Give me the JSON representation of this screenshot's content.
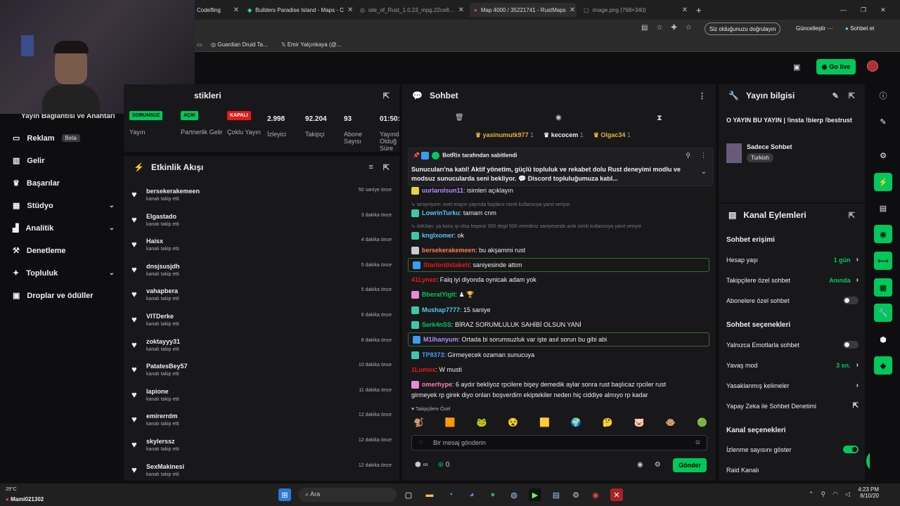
{
  "browser": {
    "tabs": [
      {
        "label": "Codefling"
      },
      {
        "label": "Builders Paradise Island - Maps - C"
      },
      {
        "label": "isle_of_Rust_1.0.23_mpg.22ce8..."
      },
      {
        "label": "Map 4000 / 35221741 - RustMaps"
      },
      {
        "label": "image.png (768×340)"
      }
    ],
    "verify_pill": "Siz olduğunuzu doğrulayın",
    "update_label": "Güncelleştir",
    "chat_label": "Sohbet et",
    "bookmarks": [
      "Guardian Druid Ta...",
      "Emir Yalçınkaya (@..."
    ]
  },
  "header": {
    "go_live": "Go live"
  },
  "sidebar": {
    "overlap_text": "Yayın Bağlantısı ve Anahtarı",
    "items": [
      {
        "label": "Reklam",
        "badge": "Beta"
      },
      {
        "label": "Gelir"
      },
      {
        "label": "Başarılar"
      },
      {
        "label": "Stüdyo"
      },
      {
        "label": "Analitik"
      },
      {
        "label": "Denetleme"
      },
      {
        "label": "Topluluk"
      },
      {
        "label": "Droplar ve ödüller"
      }
    ]
  },
  "stats": {
    "title": "stikleri",
    "cols": [
      {
        "pill": "SORUNSUZ",
        "pill_color": "#00c85a",
        "label": "Yayın"
      },
      {
        "pill": "AÇIK",
        "pill_color": "#00c85a",
        "label": "Partnerlik Gelir"
      },
      {
        "pill": "KAPALI",
        "pill_color": "#e91916",
        "label": "Çoklu Yayın"
      },
      {
        "num": "2.998",
        "label": "İzleyici"
      },
      {
        "num": "92.204",
        "label": "Takipçi"
      },
      {
        "num": "93",
        "label": "Abone Sayısı"
      },
      {
        "num": "01:50:",
        "label": "Yayında Olduğ Süre"
      }
    ]
  },
  "activity": {
    "title": "Etkinlik Akışı",
    "sub": "kanalı takip etti",
    "items": [
      {
        "name": "bersekerakemeen",
        "time": "50 saniye önce"
      },
      {
        "name": "Elgastado",
        "time": "3 dakika önce"
      },
      {
        "name": "Haisx",
        "time": "4 dakika önce"
      },
      {
        "name": "dnsjsusjdh",
        "time": "5 dakika önce"
      },
      {
        "name": "vahapbera",
        "time": "5 dakika önce"
      },
      {
        "name": "VITDerke",
        "time": "6 dakika önce"
      },
      {
        "name": "zoktayyy31",
        "time": "8 dakika önce"
      },
      {
        "name": "PatatesBey57",
        "time": "10 dakika önce"
      },
      {
        "name": "lapione",
        "time": "11 dakika önce"
      },
      {
        "name": "emirerrdm",
        "time": "12 dakika önce"
      },
      {
        "name": "skylerssz",
        "time": "12 dakika önce"
      },
      {
        "name": "SexMakinesi",
        "time": "12 dakika önce"
      }
    ]
  },
  "chat": {
    "title": "Sohbet",
    "leaders": [
      {
        "name": "yasinumutk977",
        "n": "1",
        "color": "#e6b23c"
      },
      {
        "name": "kecocem",
        "n": "1",
        "color": "#efeff1"
      },
      {
        "name": "Olgac34",
        "n": "1",
        "color": "#e6b23c"
      }
    ],
    "pinned_by": "BotRix tarafından sabitlendi",
    "pinned_text": "Sunucuları'na katıl! Aktif yönetim, güçlü topluluk ve rekabet dolu Rust deneyimi modlu ve modsuz sunucularda seni bekliyor. 💬 Discord topluluğumuza katıl...",
    "messages": [
      {
        "user": "uurlarolsun11",
        "ucolor": "#b58cff",
        "text": ": isimleri açıklayın",
        "badge": "#e6d23c"
      },
      {
        "system": "wroyniyom: evet erayın yayında başlanır isimli kullanıcıya yanıt veriyor"
      },
      {
        "user": "LowrinTurku",
        "ucolor": "#54c7f0",
        "text": ": tamam cnm",
        "badge": "#3cc8a8"
      },
      {
        "system": "itsK4an: ya konu rp olsa hepiniz 300 degil 500 verirdiniz saniyesinde amk isimli kullanıcıya yanıt veriyor"
      },
      {
        "user": "knglxomer",
        "ucolor": "#54c7f0",
        "text": ": ok",
        "badge": "#3cc8a8"
      },
      {
        "user": "bersekerakemeen",
        "ucolor": "#ff7f50",
        "text": ": bu akşammi rust",
        "badge": "#cccccc"
      },
      {
        "user": "Starlordistakeh",
        "ucolor": "#e91916",
        "text": ": saniyesinde attım",
        "badge": "#3c9cf0",
        "hl": true
      },
      {
        "user": "41Lynxe",
        "ucolor": "#e91916",
        "text": ": Falq iyi diyonda oynicak adam yok"
      },
      {
        "user": "BberatYigit",
        "ucolor": "#00c85a",
        "text": ": ♟ 🏆",
        "badge": "#e88ad6"
      },
      {
        "user": "Mushap7777",
        "ucolor": "#54c7f0",
        "text": ": 15 saniye",
        "badge": "#3cc8a8"
      },
      {
        "user": "Serk4nSS",
        "ucolor": "#00c85a",
        "text": ": BİRAZ SORUMLULUK SAHİBİ OLSUN YANİ",
        "badge": "#3cc8a8"
      },
      {
        "user": "M1lhanyum",
        "ucolor": "#b58cff",
        "text": ": Ortada bi sorumsuzluk var işte asıl sorun bu gibi abi",
        "badge": "#3c9cf0",
        "hl": true
      },
      {
        "user": "TP8373",
        "ucolor": "#3c9cf0",
        "text": ": Girmeyecek ozaman sunucuya",
        "badge": "#3cc8a8"
      },
      {
        "user": "1Lumox",
        "ucolor": "#e91916",
        "text": ": W musti"
      },
      {
        "user": "omerhype",
        "ucolor": "#ff7fb0",
        "text": ": 6 aydır bekliyoz rpcilere bişey demedik aylar sonra rust başlıcaz rpciler rust",
        "badge": "#e88ad6"
      },
      {
        "cont": "girmeyek rp girek diyo onları boşverdim ekiptekiler neden hiç ciddiye almıyo rp kadar"
      }
    ],
    "followers_only": "Takipçilere Özel",
    "input_placeholder": "Bir mesaj gönderin",
    "points": "0",
    "send": "Gönder"
  },
  "stream_info": {
    "title": "Yayın bilgisi",
    "stream_title": "O YAYIN BU YAYIN | !insta !bierp !bestrust",
    "category": "Sadece Sohbet",
    "tag": "Turkish"
  },
  "channel_actions": {
    "title": "Kanal Eylemleri",
    "chat_access": "Sohbet erişimi",
    "rows1": [
      {
        "label": "Hesap yaşı",
        "value": "1 gün",
        "type": "chev"
      },
      {
        "label": "Takipçilere özel sohbet",
        "value": "Anında",
        "type": "chev"
      },
      {
        "label": "Abonelere özel sohbet",
        "type": "toggle",
        "on": false
      }
    ],
    "chat_options": "Sohbet seçenekleri",
    "rows2": [
      {
        "label": "Yalnızca Emotlarla sohbet",
        "type": "toggle",
        "on": false
      },
      {
        "label": "Yavaş mod",
        "value": "3 sn.",
        "type": "chev"
      },
      {
        "label": "Yasaklanmış kelimeler",
        "type": "chev"
      },
      {
        "label": "Yapay Zeka ile Sohbet Denetimi",
        "type": "ext"
      }
    ],
    "channel_options": "Kanal seçenekleri",
    "rows3": [
      {
        "label": "İzlenme sayısını göster",
        "type": "toggle",
        "on": true
      },
      {
        "label": "Raid Kanalı",
        "type": "none"
      }
    ]
  },
  "taskbar": {
    "user": "Mami021302",
    "weather": "29°C",
    "search": "Ara",
    "time": "4:23 PM",
    "date": "8/10/20"
  }
}
